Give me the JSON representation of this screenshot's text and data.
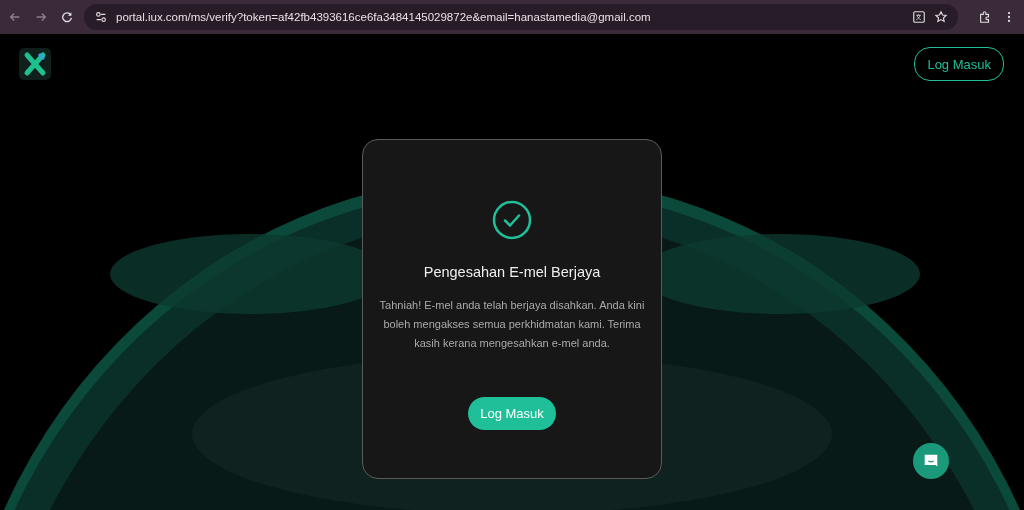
{
  "browser": {
    "url": "portal.iux.com/ms/verify?token=af42fb4393616ce6fa3484145029872e&email=hanastamedia@gmail.com"
  },
  "header": {
    "login_button": "Log Masuk"
  },
  "card": {
    "title": "Pengesahan E-mel Berjaya",
    "message": "Tahniah! E-mel anda telah berjaya disahkan. Anda kini boleh mengakses semua perkhidmatan kami. Terima kasih kerana mengesahkan e-mel anda.",
    "button": "Log Masuk"
  }
}
